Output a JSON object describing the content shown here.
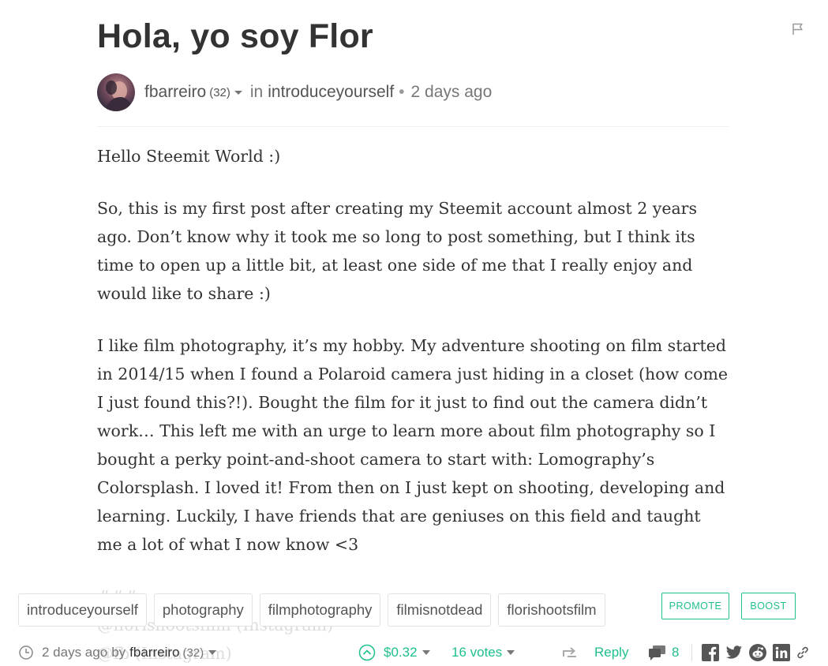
{
  "post": {
    "title": "Hola, yo soy Flor",
    "author": "fbarreiro",
    "reputation": "(32)",
    "in_label": "in",
    "category": "introduceyourself",
    "separator": "•",
    "time_ago": "2 days ago"
  },
  "body": {
    "paragraphs": [
      "Hello Steemit World :)",
      "So, this is my first post after creating my Steemit account almost 2 years ago. Don’t know why it took me so long to post something, but I think its time to open up a little bit, at least one side of me that I really enjoy and would like to share :)",
      "I like film photography, it’s my hobby. My adventure shooting on film started in 2014/15 when I found a Polaroid camera just hiding in a closet (how come I just found this?!). Bought the film for it just to find out the camera didn’t work… This left me with an urge to learn more about film photography so I bought a perky point-and-shoot camera to start with: Lomography’s Colorsplash. I loved it! From then on I just kept on shooting, developing and learning. Luckily, I have friends that are geniuses on this field and taught me a lot of what I now know <3"
    ],
    "faded_lines": [
      "###",
      "@florishootsfilm (Instagram)",
      "@fb (Instagram)"
    ]
  },
  "tags": [
    "introduceyourself",
    "photography",
    "filmphotography",
    "filmisnotdead",
    "florishootsfilm"
  ],
  "buttons": {
    "promote": "PROMOTE",
    "boost": "BOOST"
  },
  "footer": {
    "time_ago": "2 days ago",
    "by_label": "by",
    "author": "fbarreiro",
    "reputation": "(32)",
    "payout": "$0.32",
    "votes": "16 votes",
    "reply": "Reply",
    "comments": "8"
  },
  "colors": {
    "accent": "#1fbf8f",
    "text": "#333333",
    "muted": "#777777"
  },
  "icons": [
    "flag-icon",
    "clock-icon",
    "upvote-icon",
    "resteem-icon",
    "comments-icon",
    "facebook-icon",
    "twitter-icon",
    "reddit-icon",
    "linkedin-icon",
    "link-icon"
  ]
}
